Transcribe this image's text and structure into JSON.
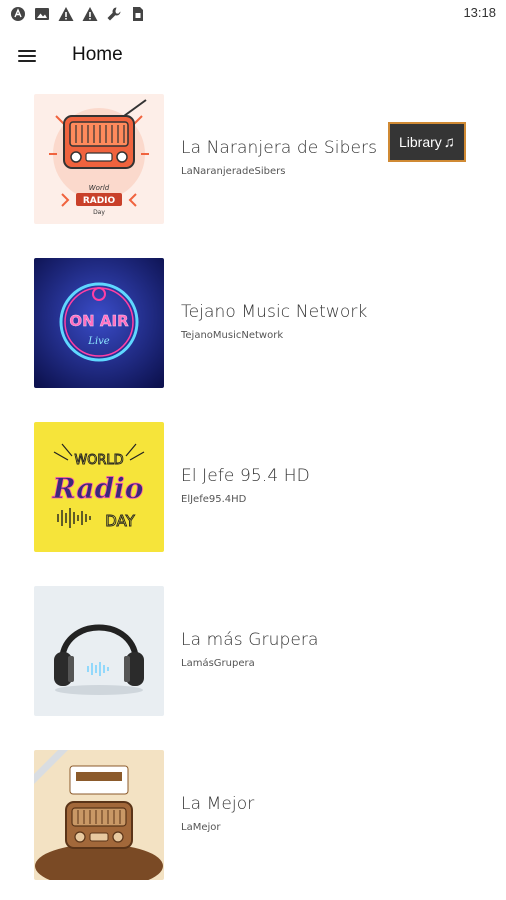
{
  "status_bar": {
    "time": "13:18",
    "icons": [
      "android-icon",
      "image-icon",
      "warning-icon",
      "warning-icon",
      "wrench-icon",
      "sim-icon"
    ]
  },
  "app_bar": {
    "title": "Home",
    "menu_icon": "hamburger-menu-icon"
  },
  "library_button": {
    "label": "Library",
    "icon": "music-note-icon"
  },
  "stations": [
    {
      "title": "La Naranjera de Sibers",
      "subtitle": "LaNaranjeradeSibers",
      "thumbnail": "world-radio-day-orange"
    },
    {
      "title": "Tejano Music Network",
      "subtitle": "TejanoMusicNetwork",
      "thumbnail": "on-air-neon"
    },
    {
      "title": "El Jefe 95.4 HD",
      "subtitle": "ElJefe95.4HD",
      "thumbnail": "world-radio-day-yellow"
    },
    {
      "title": "La más Grupera",
      "subtitle": "LamásGrupera",
      "thumbnail": "headphones"
    },
    {
      "title": "La Mejor",
      "subtitle": "LaMejor",
      "thumbnail": "vintage-radio"
    }
  ],
  "thumb_text": {
    "on_air": "ON AIR",
    "live": "Live",
    "world": "WORLD",
    "radio": "Radio",
    "day": "DAY",
    "world_small": "World",
    "radio_small": "RADIO",
    "day_small": "Day"
  },
  "colors": {
    "library_border": "#d08a34",
    "library_bg": "#353535",
    "orange": "#f0633e",
    "neon_pink": "#ff3fa4",
    "yellow": "#f6e43a"
  }
}
